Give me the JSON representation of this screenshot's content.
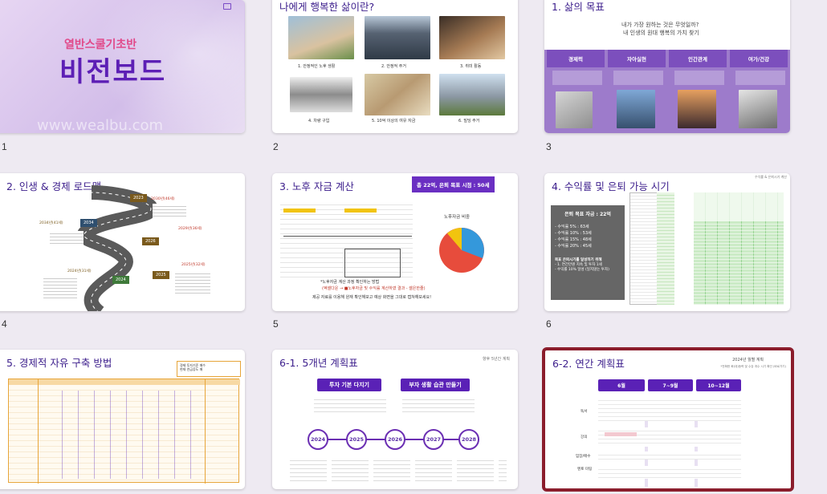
{
  "slides": [
    {
      "number": "1",
      "title_small": "열반스쿨기초반",
      "title_big": "비전보드",
      "watermark": "www.wealbu.com"
    },
    {
      "number": "2",
      "title": "나에게 행복한 삶이란?",
      "captions": [
        "1. 안정적인 노후 생활",
        "2. 안정적 주거",
        "3. 취미 활동",
        "4. 차량 구입",
        "5. 10억 이상의 여유 자금",
        "6. 빌딩 주거"
      ]
    },
    {
      "number": "3",
      "title": "1. 삶의 목표",
      "subtitle1": "내가 가장 원하는 것은 무엇일까?",
      "subtitle2": "내 인생의 원대 행복의 가치 찾기",
      "columns": [
        "경제력",
        "자아실현",
        "인간관계",
        "여가/건강"
      ]
    },
    {
      "number": "4",
      "title": "2. 인생 & 경제 로드맵",
      "years": [
        "2024",
        "2025",
        "2026",
        "2034",
        "2023"
      ],
      "labels": [
        "2034년(41세)",
        "2030년(46세)",
        "2029년(36세)",
        "2024년(31세)",
        "2025년(32세)"
      ]
    },
    {
      "number": "5",
      "title": "3. 노후 자금 계산",
      "badge": "총 22억, 은퇴 목표 시점 : 50세",
      "pie_title": "노후자금 비중",
      "note1": "*노후자금 계산 과정 확인하는 방법",
      "note2": "(엑셀다운 → ■노후자금 및 수익률 계산하였 결과 - 셀은한줄)",
      "note3": "제공 자료를 이용해 원재 확인해보고 예상 화면을 그대로 캡쳐해보세요!"
    },
    {
      "number": "6",
      "title": "4. 수익률 및 은퇴 가능 시기",
      "corner": "수익률 & 은퇴시기 계산",
      "box_title": "은퇴 목표 자금 : 22억",
      "box_lines": [
        "- 수익률 5% : 63세",
        "- 수익률 10% : 53세",
        "- 수익률 15% : 48세",
        "- 수익률 20% : 45세"
      ],
      "box_bottom": [
        "목표 은퇴시기를 달성하기 위해",
        "- 1. 연간만원 지속 및 투자 1세",
        "- 수익률 10% 달성 (일지않는 투자)"
      ]
    },
    {
      "number": "",
      "title": "5. 경제적 자유 구축 방법",
      "legend": [
        "경제 투자기준 매수",
        "현재 연금증도 매"
      ]
    },
    {
      "number": "",
      "title": "6-1. 5개년 계획표",
      "corner": "향후 5년간 계획",
      "btn1": "투자 기본 다지기",
      "btn2": "부자 생활 습관 만들기",
      "years": [
        "2024",
        "2025",
        "2026",
        "2027",
        "2028"
      ]
    },
    {
      "number": "",
      "title": "6-2. 연간 계획표",
      "corner": "2024년 월별 계획",
      "corner2": "*전확한 화(대)등력 및 수강 개수 시기 확인 (바로가기)",
      "headers": [
        "6월",
        "7~9월",
        "10~12월"
      ],
      "rows": [
        "독서",
        "강의",
        "임장/매수",
        "멘토 미팅"
      ]
    }
  ],
  "colors": {
    "accent": "#5a21b6",
    "selected_border": "#8b1d2c",
    "background": "#eeeaf2"
  }
}
